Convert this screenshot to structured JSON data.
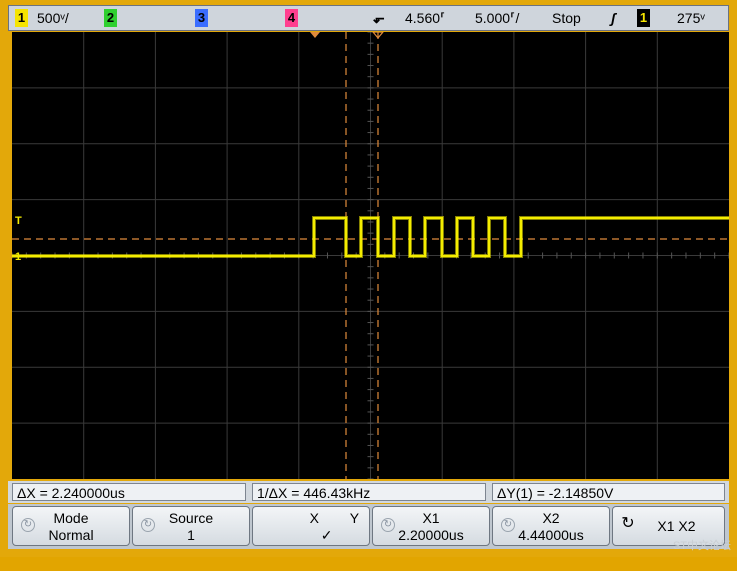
{
  "status": {
    "ch1": {
      "num": "1",
      "scale": "500ᵛ/",
      "color": "#f5e400"
    },
    "ch2": {
      "num": "2",
      "color": "#30d030"
    },
    "ch3": {
      "num": "3",
      "color": "#3a6dff"
    },
    "ch4": {
      "num": "4",
      "color": "#ff3f8f"
    },
    "trigger_icon": "trigger-delay-icon",
    "delay": "4.560⸢",
    "timebase": "5.000⸢/",
    "run_state": "Stop",
    "slope_icon": "rising-edge-icon",
    "trig_source": "1",
    "trig_level": "275ᵛ"
  },
  "screen": {
    "trace_color": "#f4ec00",
    "cursor_color": "#e08b3c",
    "markers": {
      "trigger_level": "T",
      "ch1_ground": "1"
    }
  },
  "measurements": {
    "dx": "ΔX = 2.240000us",
    "inv_dx": "1/ΔX = 446.43kHz",
    "dy": "ΔY(1) = -2.14850V"
  },
  "softkeys": [
    {
      "title": "Mode",
      "value": "Normal",
      "knob": true
    },
    {
      "title": "Source",
      "value": "1",
      "knob": true
    },
    {
      "title": "X        Y",
      "value": "✓    ",
      "knob": false
    },
    {
      "title": "X1",
      "value": "2.20000us",
      "knob": true
    },
    {
      "title": "X2",
      "value": "4.44000us",
      "knob": true
    },
    {
      "title": "X1 X2",
      "value": "",
      "knob": true
    }
  ],
  "watermark": "ST中文论坛"
}
